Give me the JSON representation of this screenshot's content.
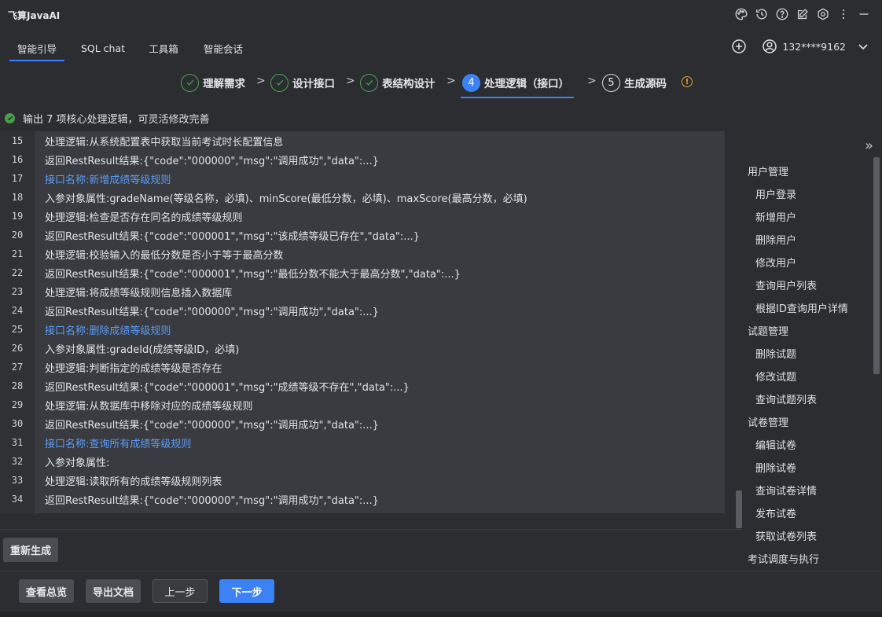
{
  "app": {
    "title": "飞算JavaAI"
  },
  "tabs": [
    {
      "label": "智能引导",
      "active": true
    },
    {
      "label": "SQL chat",
      "active": false
    },
    {
      "label": "工具箱",
      "active": false
    },
    {
      "label": "智能会话",
      "active": false
    }
  ],
  "user": {
    "phone": "132****9162"
  },
  "steps": [
    {
      "num": "1",
      "label": "理解需求",
      "state": "done"
    },
    {
      "num": "2",
      "label": "设计接口",
      "state": "done"
    },
    {
      "num": "3",
      "label": "表结构设计",
      "state": "done"
    },
    {
      "num": "4",
      "label": "处理逻辑（接口）",
      "state": "active"
    },
    {
      "num": "5",
      "label": "生成源码",
      "state": "todo"
    }
  ],
  "status": {
    "text": "输出 7 项核心处理逻辑，可灵活修改完善"
  },
  "code_lines": [
    {
      "n": "15",
      "text": "处理逻辑:从系统配置表中获取当前考试时长配置信息",
      "highlight": false
    },
    {
      "n": "16",
      "text": "返回RestResult结果:{\"code\":\"000000\",\"msg\":\"调用成功\",\"data\":...}",
      "highlight": false
    },
    {
      "n": "17",
      "text": "接口名称:新增成绩等级规则",
      "highlight": true
    },
    {
      "n": "18",
      "text": "入参对象属性:gradeName(等级名称，必填)、minScore(最低分数，必填)、maxScore(最高分数，必填)",
      "highlight": false
    },
    {
      "n": "19",
      "text": "处理逻辑:检查是否存在同名的成绩等级规则",
      "highlight": false
    },
    {
      "n": "20",
      "text": "返回RestResult结果:{\"code\":\"000001\",\"msg\":\"该成绩等级已存在\",\"data\":...}",
      "highlight": false
    },
    {
      "n": "21",
      "text": "处理逻辑:校验输入的最低分数是否小于等于最高分数",
      "highlight": false
    },
    {
      "n": "22",
      "text": "返回RestResult结果:{\"code\":\"000001\",\"msg\":\"最低分数不能大于最高分数\",\"data\":...}",
      "highlight": false
    },
    {
      "n": "23",
      "text": "处理逻辑:将成绩等级规则信息插入数据库",
      "highlight": false
    },
    {
      "n": "24",
      "text": "返回RestResult结果:{\"code\":\"000000\",\"msg\":\"调用成功\",\"data\":...}",
      "highlight": false
    },
    {
      "n": "25",
      "text": "接口名称:删除成绩等级规则",
      "highlight": true
    },
    {
      "n": "26",
      "text": "入参对象属性:gradeId(成绩等级ID，必填)",
      "highlight": false
    },
    {
      "n": "27",
      "text": "处理逻辑:判断指定的成绩等级是否存在",
      "highlight": false
    },
    {
      "n": "28",
      "text": "返回RestResult结果:{\"code\":\"000001\",\"msg\":\"成绩等级不存在\",\"data\":...}",
      "highlight": false
    },
    {
      "n": "29",
      "text": "处理逻辑:从数据库中移除对应的成绩等级规则",
      "highlight": false
    },
    {
      "n": "30",
      "text": "返回RestResult结果:{\"code\":\"000000\",\"msg\":\"调用成功\",\"data\":...}",
      "highlight": false
    },
    {
      "n": "31",
      "text": "接口名称:查询所有成绩等级规则",
      "highlight": true
    },
    {
      "n": "32",
      "text": "入参对象属性:",
      "highlight": false
    },
    {
      "n": "33",
      "text": "处理逻辑:读取所有的成绩等级规则列表",
      "highlight": false
    },
    {
      "n": "34",
      "text": "返回RestResult结果:{\"code\":\"000000\",\"msg\":\"调用成功\",\"data\":...}",
      "highlight": false
    }
  ],
  "outline": [
    {
      "label": "用户管理",
      "level": 0
    },
    {
      "label": "用户登录",
      "level": 1
    },
    {
      "label": "新增用户",
      "level": 1
    },
    {
      "label": "删除用户",
      "level": 1
    },
    {
      "label": "修改用户",
      "level": 1
    },
    {
      "label": "查询用户列表",
      "level": 1
    },
    {
      "label": "根据ID查询用户详情",
      "level": 1
    },
    {
      "label": "试题管理",
      "level": 0
    },
    {
      "label": "删除试题",
      "level": 1
    },
    {
      "label": "修改试题",
      "level": 1
    },
    {
      "label": "查询试题列表",
      "level": 1
    },
    {
      "label": "试卷管理",
      "level": 0
    },
    {
      "label": "编辑试卷",
      "level": 1
    },
    {
      "label": "删除试卷",
      "level": 1
    },
    {
      "label": "查询试卷详情",
      "level": 1
    },
    {
      "label": "发布试卷",
      "level": 1
    },
    {
      "label": "获取试卷列表",
      "level": 1
    },
    {
      "label": "考试调度与执行",
      "level": 0
    }
  ],
  "buttons": {
    "regenerate": "重新生成",
    "overview": "查看总览",
    "export": "导出文档",
    "prev": "上一步",
    "next": "下一步"
  },
  "colors": {
    "accent": "#3b82f6",
    "success": "#4ea24f",
    "link": "#5b9cf5",
    "warning": "#e7a532"
  }
}
